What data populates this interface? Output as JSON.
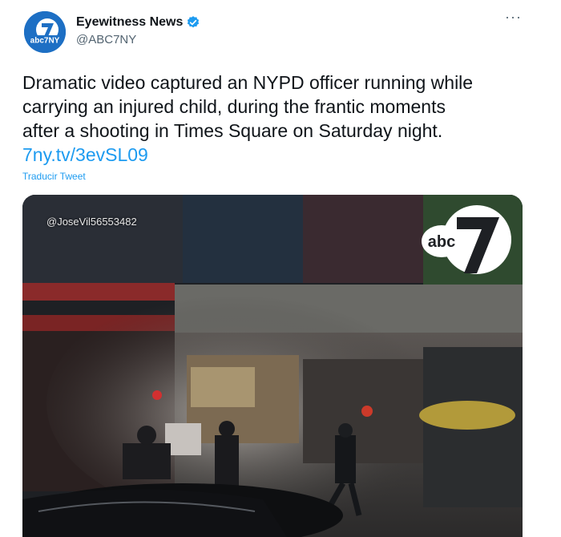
{
  "author": {
    "display_name": "Eyewitness News",
    "handle": "@ABC7NY",
    "avatar_text": "abc7NY",
    "verified": true
  },
  "tweet": {
    "lines": [
      "Dramatic video captured an NYPD officer running while",
      "carrying an injured child, during the frantic moments",
      "after a shooting in Times Square on Saturday night."
    ],
    "link": "7ny.tv/3evSL09",
    "translate_label": "Traducir Tweet"
  },
  "media": {
    "watermark": "@JoseVil56553482",
    "logo_text": "abc"
  },
  "colors": {
    "link": "#1d9bf0",
    "avatar_bg": "#1d6fc4",
    "verified": "#1d9bf0"
  },
  "icons": [
    "verified-badge-icon",
    "more-options-icon",
    "abc7-logo-icon"
  ]
}
